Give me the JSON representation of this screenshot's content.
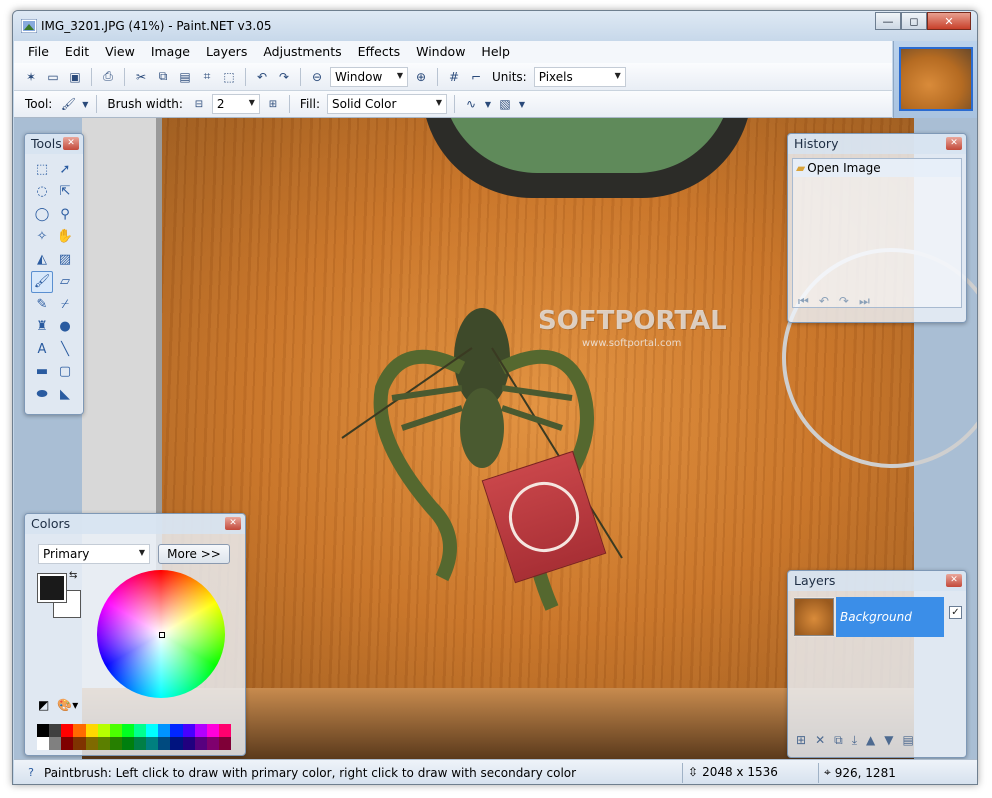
{
  "window": {
    "title": "IMG_3201.JPG (41%) - Paint.NET v3.05",
    "buttons": {
      "minimize": "—",
      "maximize": "◻",
      "close": "✕"
    }
  },
  "menu": [
    "File",
    "Edit",
    "View",
    "Image",
    "Layers",
    "Adjustments",
    "Effects",
    "Window",
    "Help"
  ],
  "toolbar": {
    "zoom_mode": "Window",
    "units_label": "Units:",
    "units_value": "Pixels",
    "tool_label": "Tool:",
    "brush_width_label": "Brush width:",
    "brush_width_value": "2",
    "fill_label": "Fill:",
    "fill_value": "Solid Color"
  },
  "watermark": {
    "brand": "SOFTPORTAL",
    "url": "www.softportal.com"
  },
  "tools_panel": {
    "title": "Tools",
    "tools": [
      "rectangle-select",
      "move-selection",
      "lasso-select",
      "move-selection-outline",
      "ellipse-select",
      "zoom",
      "magic-wand",
      "pan",
      "paint-bucket",
      "gradient",
      "paintbrush",
      "eraser",
      "pencil",
      "color-picker",
      "clone-stamp",
      "recolor",
      "text",
      "line-curve",
      "rectangle",
      "rounded-rectangle",
      "ellipse",
      "freeform-shape"
    ]
  },
  "history_panel": {
    "title": "History",
    "items": [
      "Open Image"
    ]
  },
  "colors_panel": {
    "title": "Colors",
    "mode": "Primary",
    "more_label": "More >>",
    "primary_color": "#1a1a1a",
    "secondary_color": "#ffffff",
    "palette": [
      "#000000",
      "#404040",
      "#ff0000",
      "#ff6a00",
      "#ffd800",
      "#b6ff00",
      "#4cff00",
      "#00ff21",
      "#00ff90",
      "#00ffff",
      "#0094ff",
      "#0026ff",
      "#4800ff",
      "#b200ff",
      "#ff00dc",
      "#ff006e",
      "#ffffff",
      "#808080",
      "#7f0000",
      "#7f3300",
      "#7f6a00",
      "#5b7f00",
      "#267f00",
      "#007f0e",
      "#007f46",
      "#007f7f",
      "#004a7f",
      "#00137f",
      "#21007f",
      "#57007f",
      "#7f006e",
      "#7f0037"
    ]
  },
  "layers_panel": {
    "title": "Layers",
    "layers": [
      {
        "name": "Background",
        "visible": true
      }
    ]
  },
  "status": {
    "message": "Paintbrush: Left click to draw with primary color, right click to draw with secondary color",
    "image_size": "2048 x 1536",
    "cursor_position": "926, 1281"
  }
}
